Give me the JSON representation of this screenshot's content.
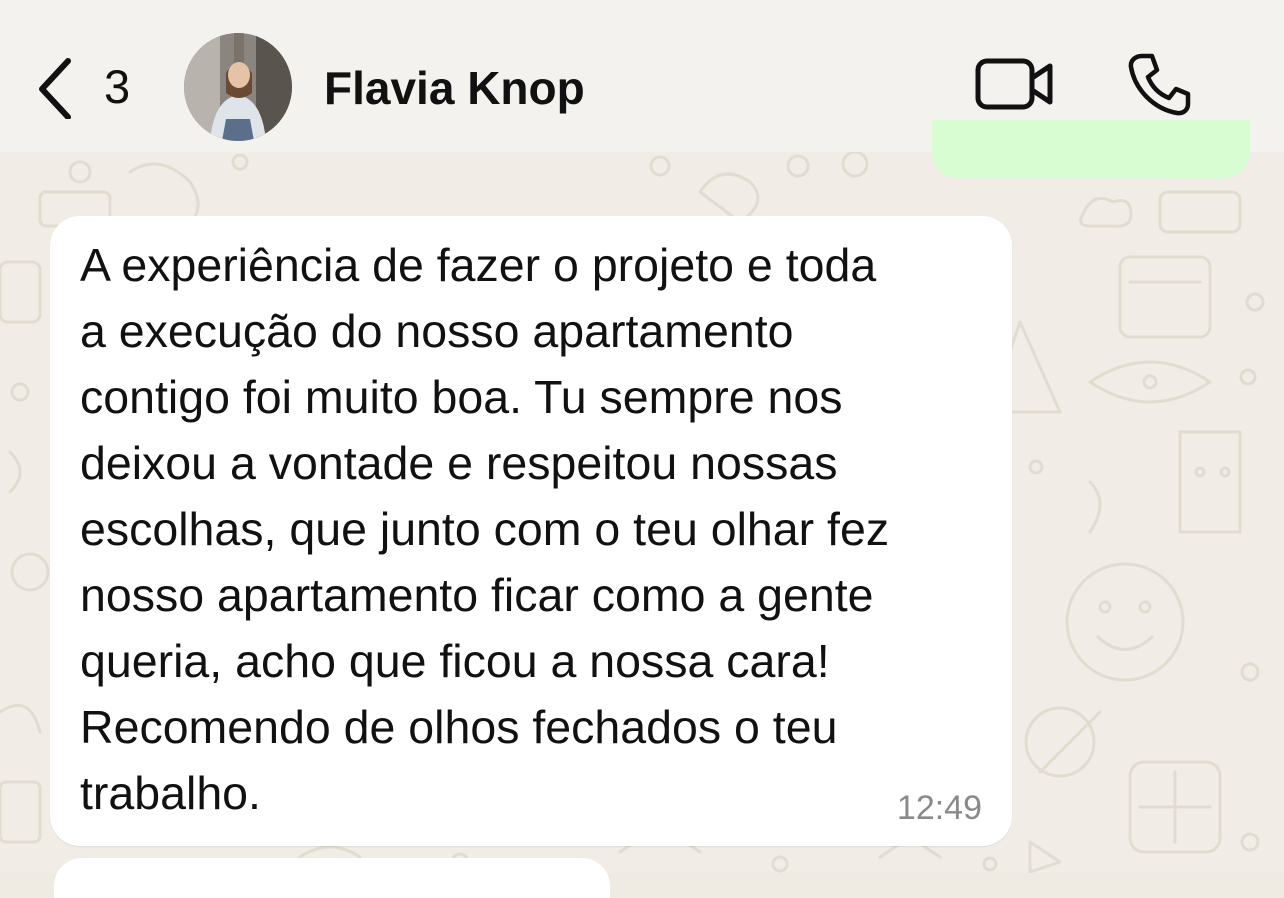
{
  "header": {
    "unread_count": "3",
    "contact_name": "Flavia Knop",
    "icons": {
      "back": "chevron-left-icon",
      "video": "video-camera-icon",
      "call": "phone-icon"
    }
  },
  "messages": [
    {
      "direction": "incoming",
      "text": "A experiência de fazer o projeto e toda\na execução do nosso apartamento\ncontigo foi muito boa. Tu sempre nos\ndeixou a vontade e respeitou nossas\nescolhas, que junto com o teu olhar fez\nnosso apartamento ficar como a gente\nqueria, acho que ficou a nossa cara!\nRecomendo de olhos fechados o teu\ntrabalho.",
      "time": "12:49"
    }
  ],
  "colors": {
    "header_bg": "#f4f2ee",
    "wallpaper_bg": "#f1ede6",
    "incoming_bubble": "#ffffff",
    "outgoing_bubble": "#d9fdd3",
    "timestamp": "#8a8a8a"
  }
}
